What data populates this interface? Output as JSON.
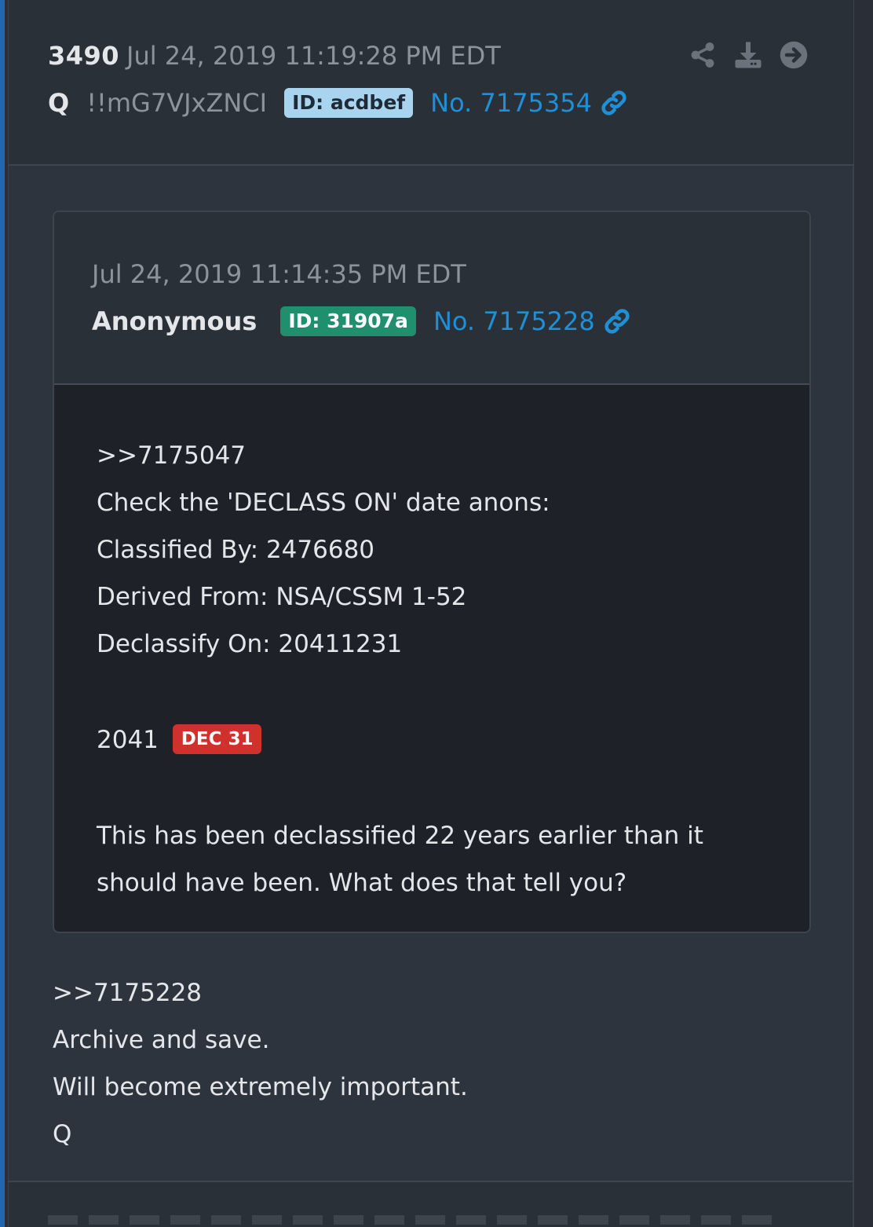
{
  "post": {
    "number": "3490",
    "date": "Jul 24, 2019 11:19:28 PM EDT",
    "author": "Q",
    "tripcode": "!!mG7VJxZNCI",
    "id_label": "ID: acdbef",
    "post_no": "No. 7175354",
    "actions": [
      "share-icon",
      "download-icon",
      "arrow-right-icon"
    ],
    "body": [
      ">>7175228",
      "Archive and save.",
      "Will become extremely important.",
      "Q"
    ]
  },
  "quoted": {
    "date": "Jul 24, 2019 11:14:35 PM EDT",
    "author": "Anonymous",
    "id_label": "ID: 31907a",
    "post_no": "No. 7175228",
    "lines": [
      ">>7175047",
      "Check the 'DECLASS ON' date anons:",
      "Classified By: 2476680",
      "Derived From: NSA/CSSM 1-52",
      "Declassify On: 20411231"
    ],
    "year": "2041",
    "date_badge": "DEC 31",
    "closing": "This has been declassified 22 years earlier than it should have been. What does that tell you?"
  },
  "colors": {
    "accent": "#2563b5",
    "link": "#1f8fd6",
    "q_id_badge": "#a9d4ef",
    "anon_id_badge": "#1f8f6e",
    "date_badge": "#d0312d"
  }
}
